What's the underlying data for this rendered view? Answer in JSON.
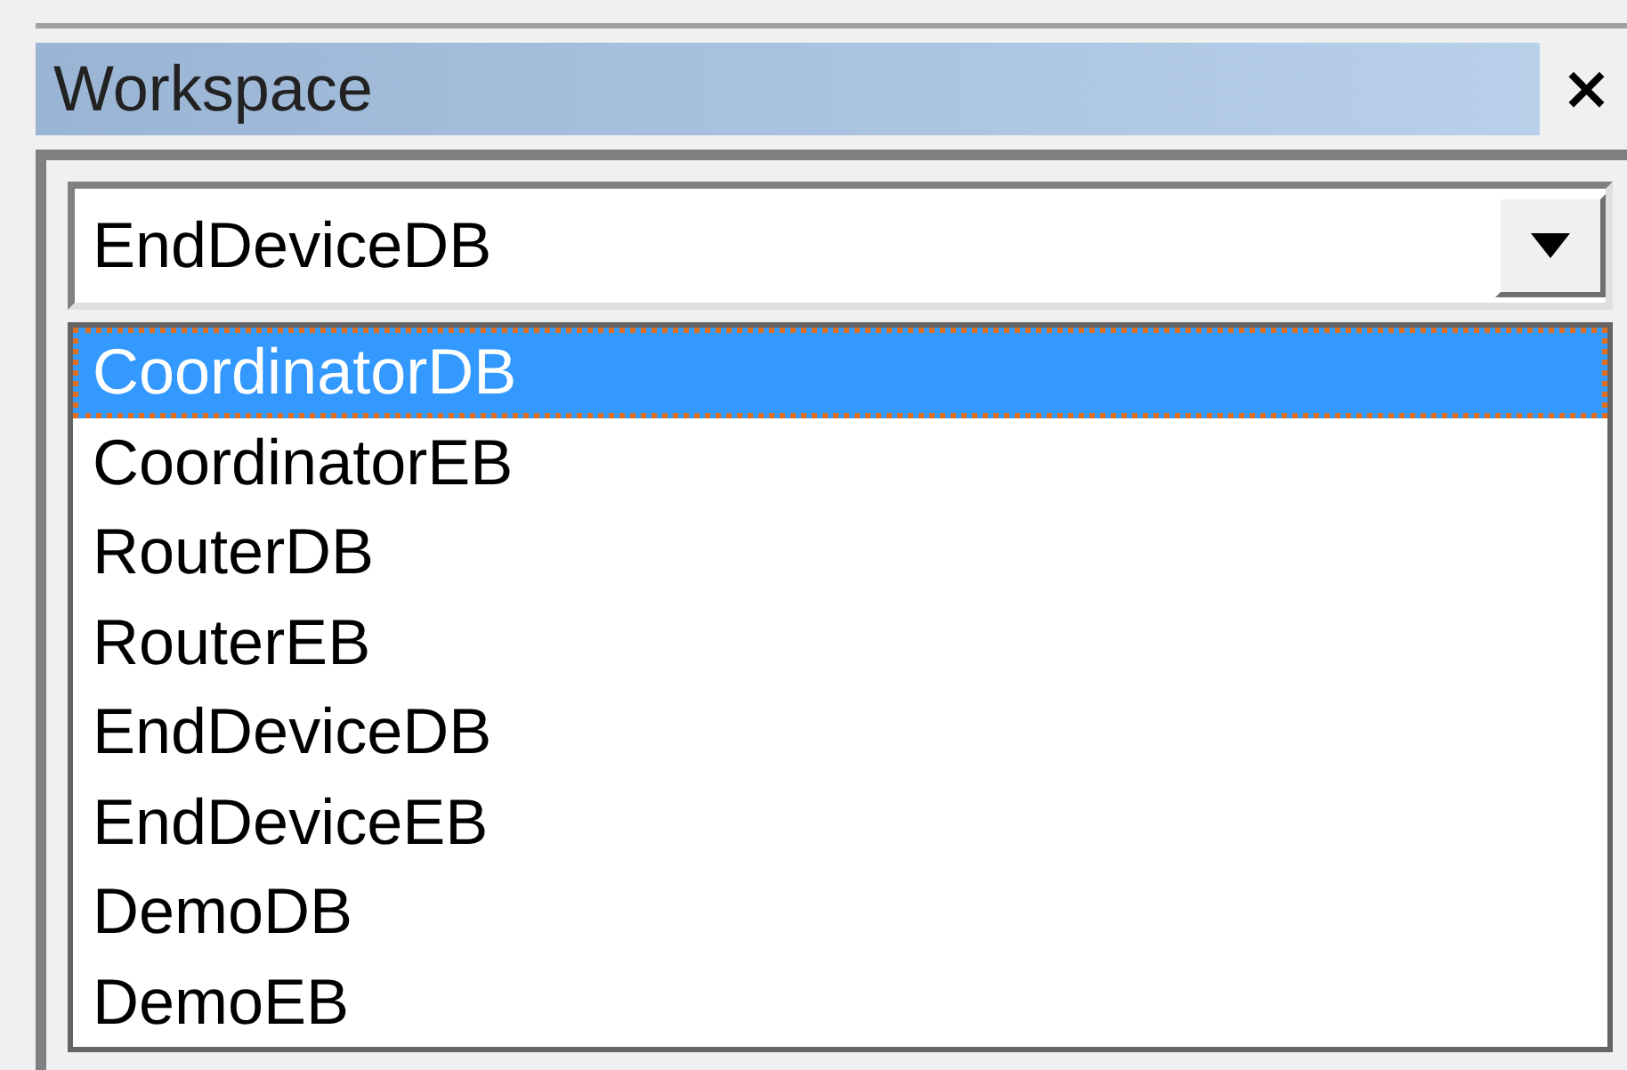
{
  "panel": {
    "title": "Workspace",
    "close": "×"
  },
  "combo": {
    "value": "EndDeviceDB",
    "expanded": true
  },
  "options": [
    {
      "label": "CoordinatorDB",
      "selected": true
    },
    {
      "label": "CoordinatorEB",
      "selected": false
    },
    {
      "label": "RouterDB",
      "selected": false
    },
    {
      "label": "RouterEB",
      "selected": false
    },
    {
      "label": "EndDeviceDB",
      "selected": false
    },
    {
      "label": "EndDeviceEB",
      "selected": false
    },
    {
      "label": "DemoDB",
      "selected": false
    },
    {
      "label": "DemoEB",
      "selected": false
    }
  ]
}
